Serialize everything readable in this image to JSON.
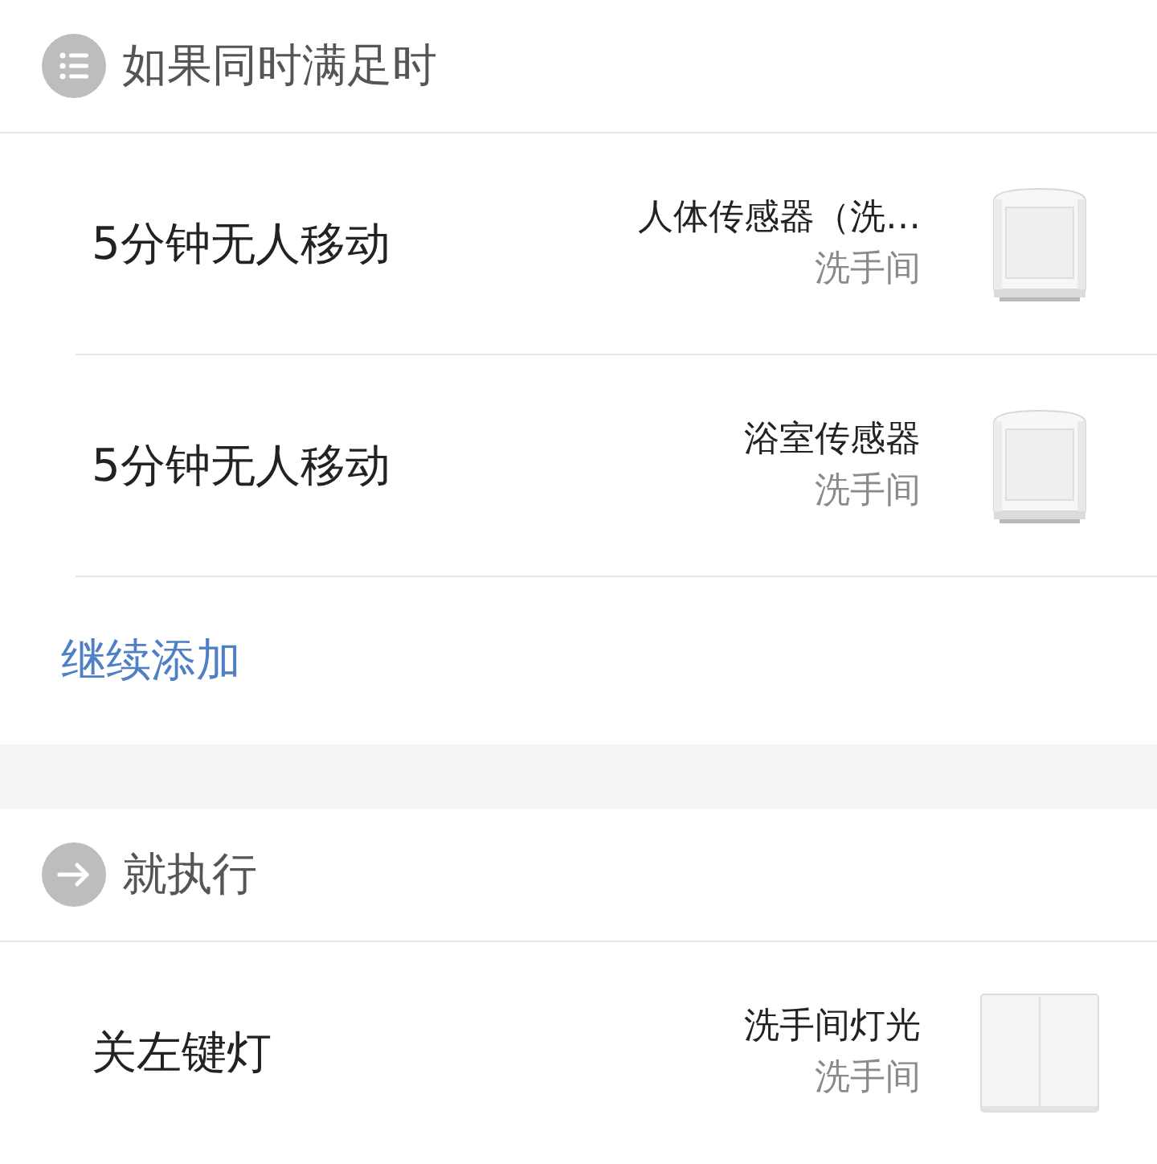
{
  "sections": [
    {
      "kind": "condition",
      "title": "如果同时满足时",
      "items": [
        {
          "kind": "motion-sensor",
          "label": "5分钟无人移动",
          "device": "人体传感器（洗…",
          "room": "洗手间"
        },
        {
          "kind": "motion-sensor",
          "label": "5分钟无人移动",
          "device": "浴室传感器",
          "room": "洗手间"
        }
      ],
      "add_link": "继续添加"
    },
    {
      "kind": "action",
      "title": "就执行",
      "items": [
        {
          "kind": "wall-switch",
          "label": "关左键灯",
          "device": "洗手间灯光",
          "room": "洗手间"
        }
      ]
    }
  ]
}
